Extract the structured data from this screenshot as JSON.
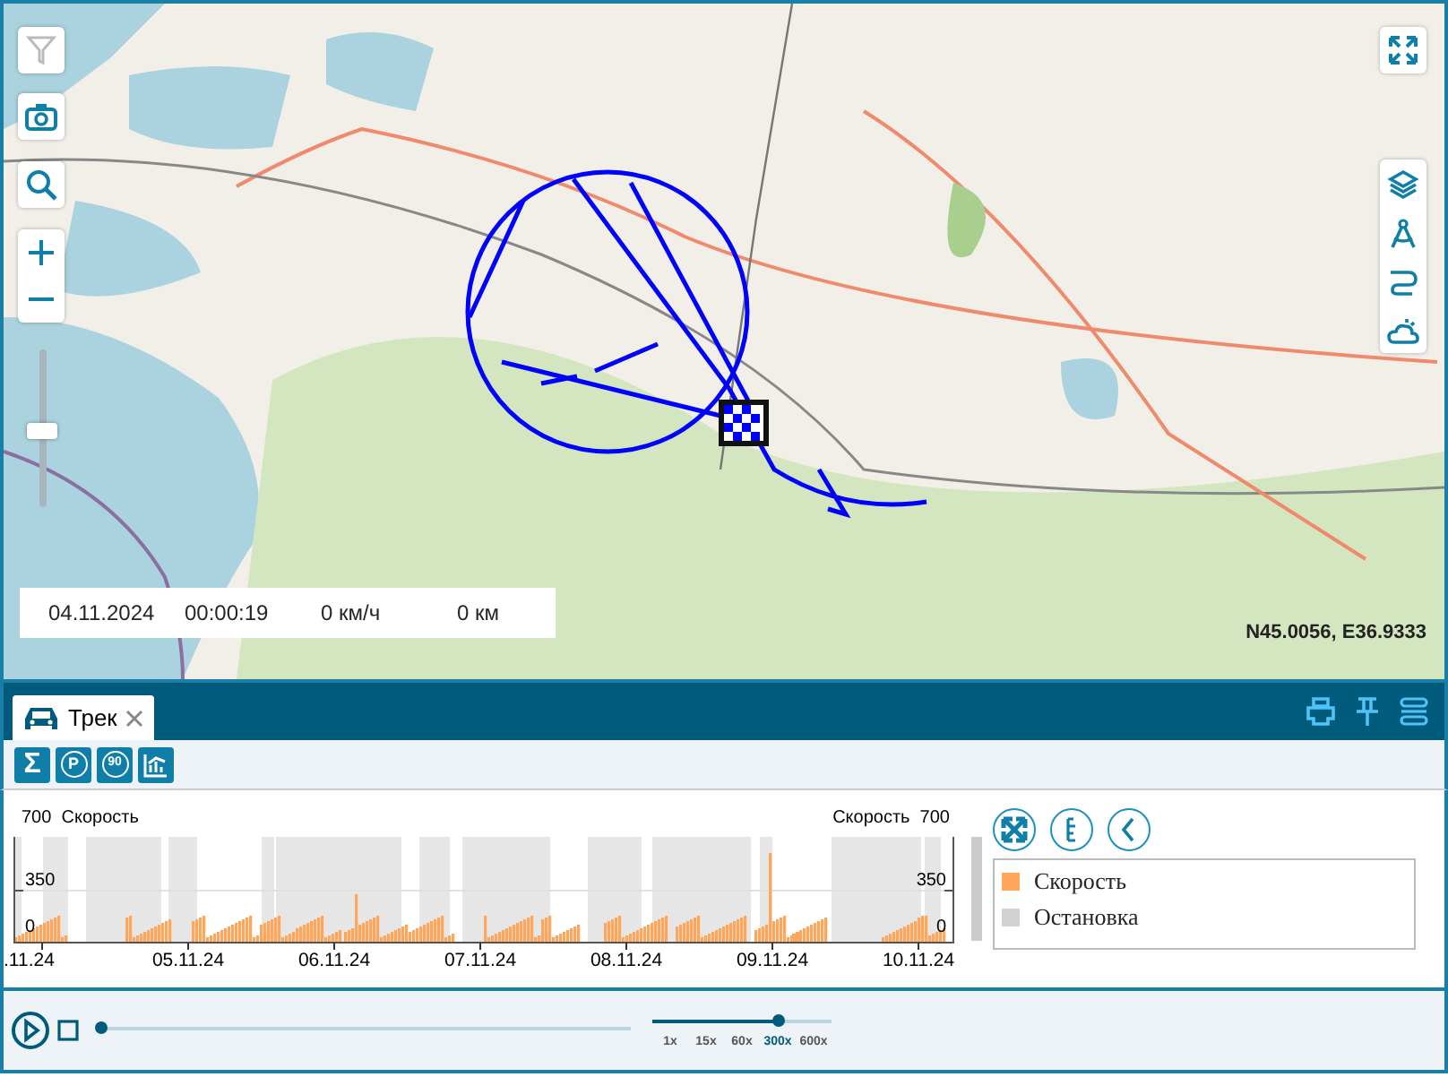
{
  "map": {
    "zoom_slider": {
      "level": 0.48
    },
    "info_bar": {
      "date": "04.11.2024",
      "time": "00:00:19",
      "speed": "0 км/ч",
      "distance": "0 км"
    },
    "coordinates": "N45.0056, E36.9333"
  },
  "panel": {
    "tabs": [
      {
        "label": "Трек",
        "selected": true
      }
    ],
    "toolbar": [
      {
        "kind": "sum",
        "glyph": "Σ"
      },
      {
        "kind": "parking",
        "glyph": "P"
      },
      {
        "kind": "speed-limit",
        "glyph": "90"
      },
      {
        "kind": "chart"
      }
    ],
    "speed_graph": {
      "left_title": "700  Скорость",
      "right_title": "Скорость  700",
      "left_ticks": [
        "350",
        "0"
      ],
      "right_ticks": [
        "350",
        "0"
      ],
      "dates": [
        ".11.24",
        "05.11.24",
        "06.11.24",
        "07.11.24",
        "08.11.24",
        "09.11.24",
        "10.11.24"
      ]
    },
    "legend": [
      {
        "label": "Скорость",
        "color": "#ffa65a"
      },
      {
        "label": "Остановка",
        "color": "#d3d3d3"
      }
    ]
  },
  "player": {
    "progress": {
      "level": 0
    },
    "speeds": [
      {
        "label": "1x",
        "selected": false
      },
      {
        "label": "15x",
        "selected": false
      },
      {
        "label": "60x",
        "selected": false
      },
      {
        "label": "300x",
        "selected": true
      },
      {
        "label": "600x",
        "selected": false
      }
    ]
  }
}
